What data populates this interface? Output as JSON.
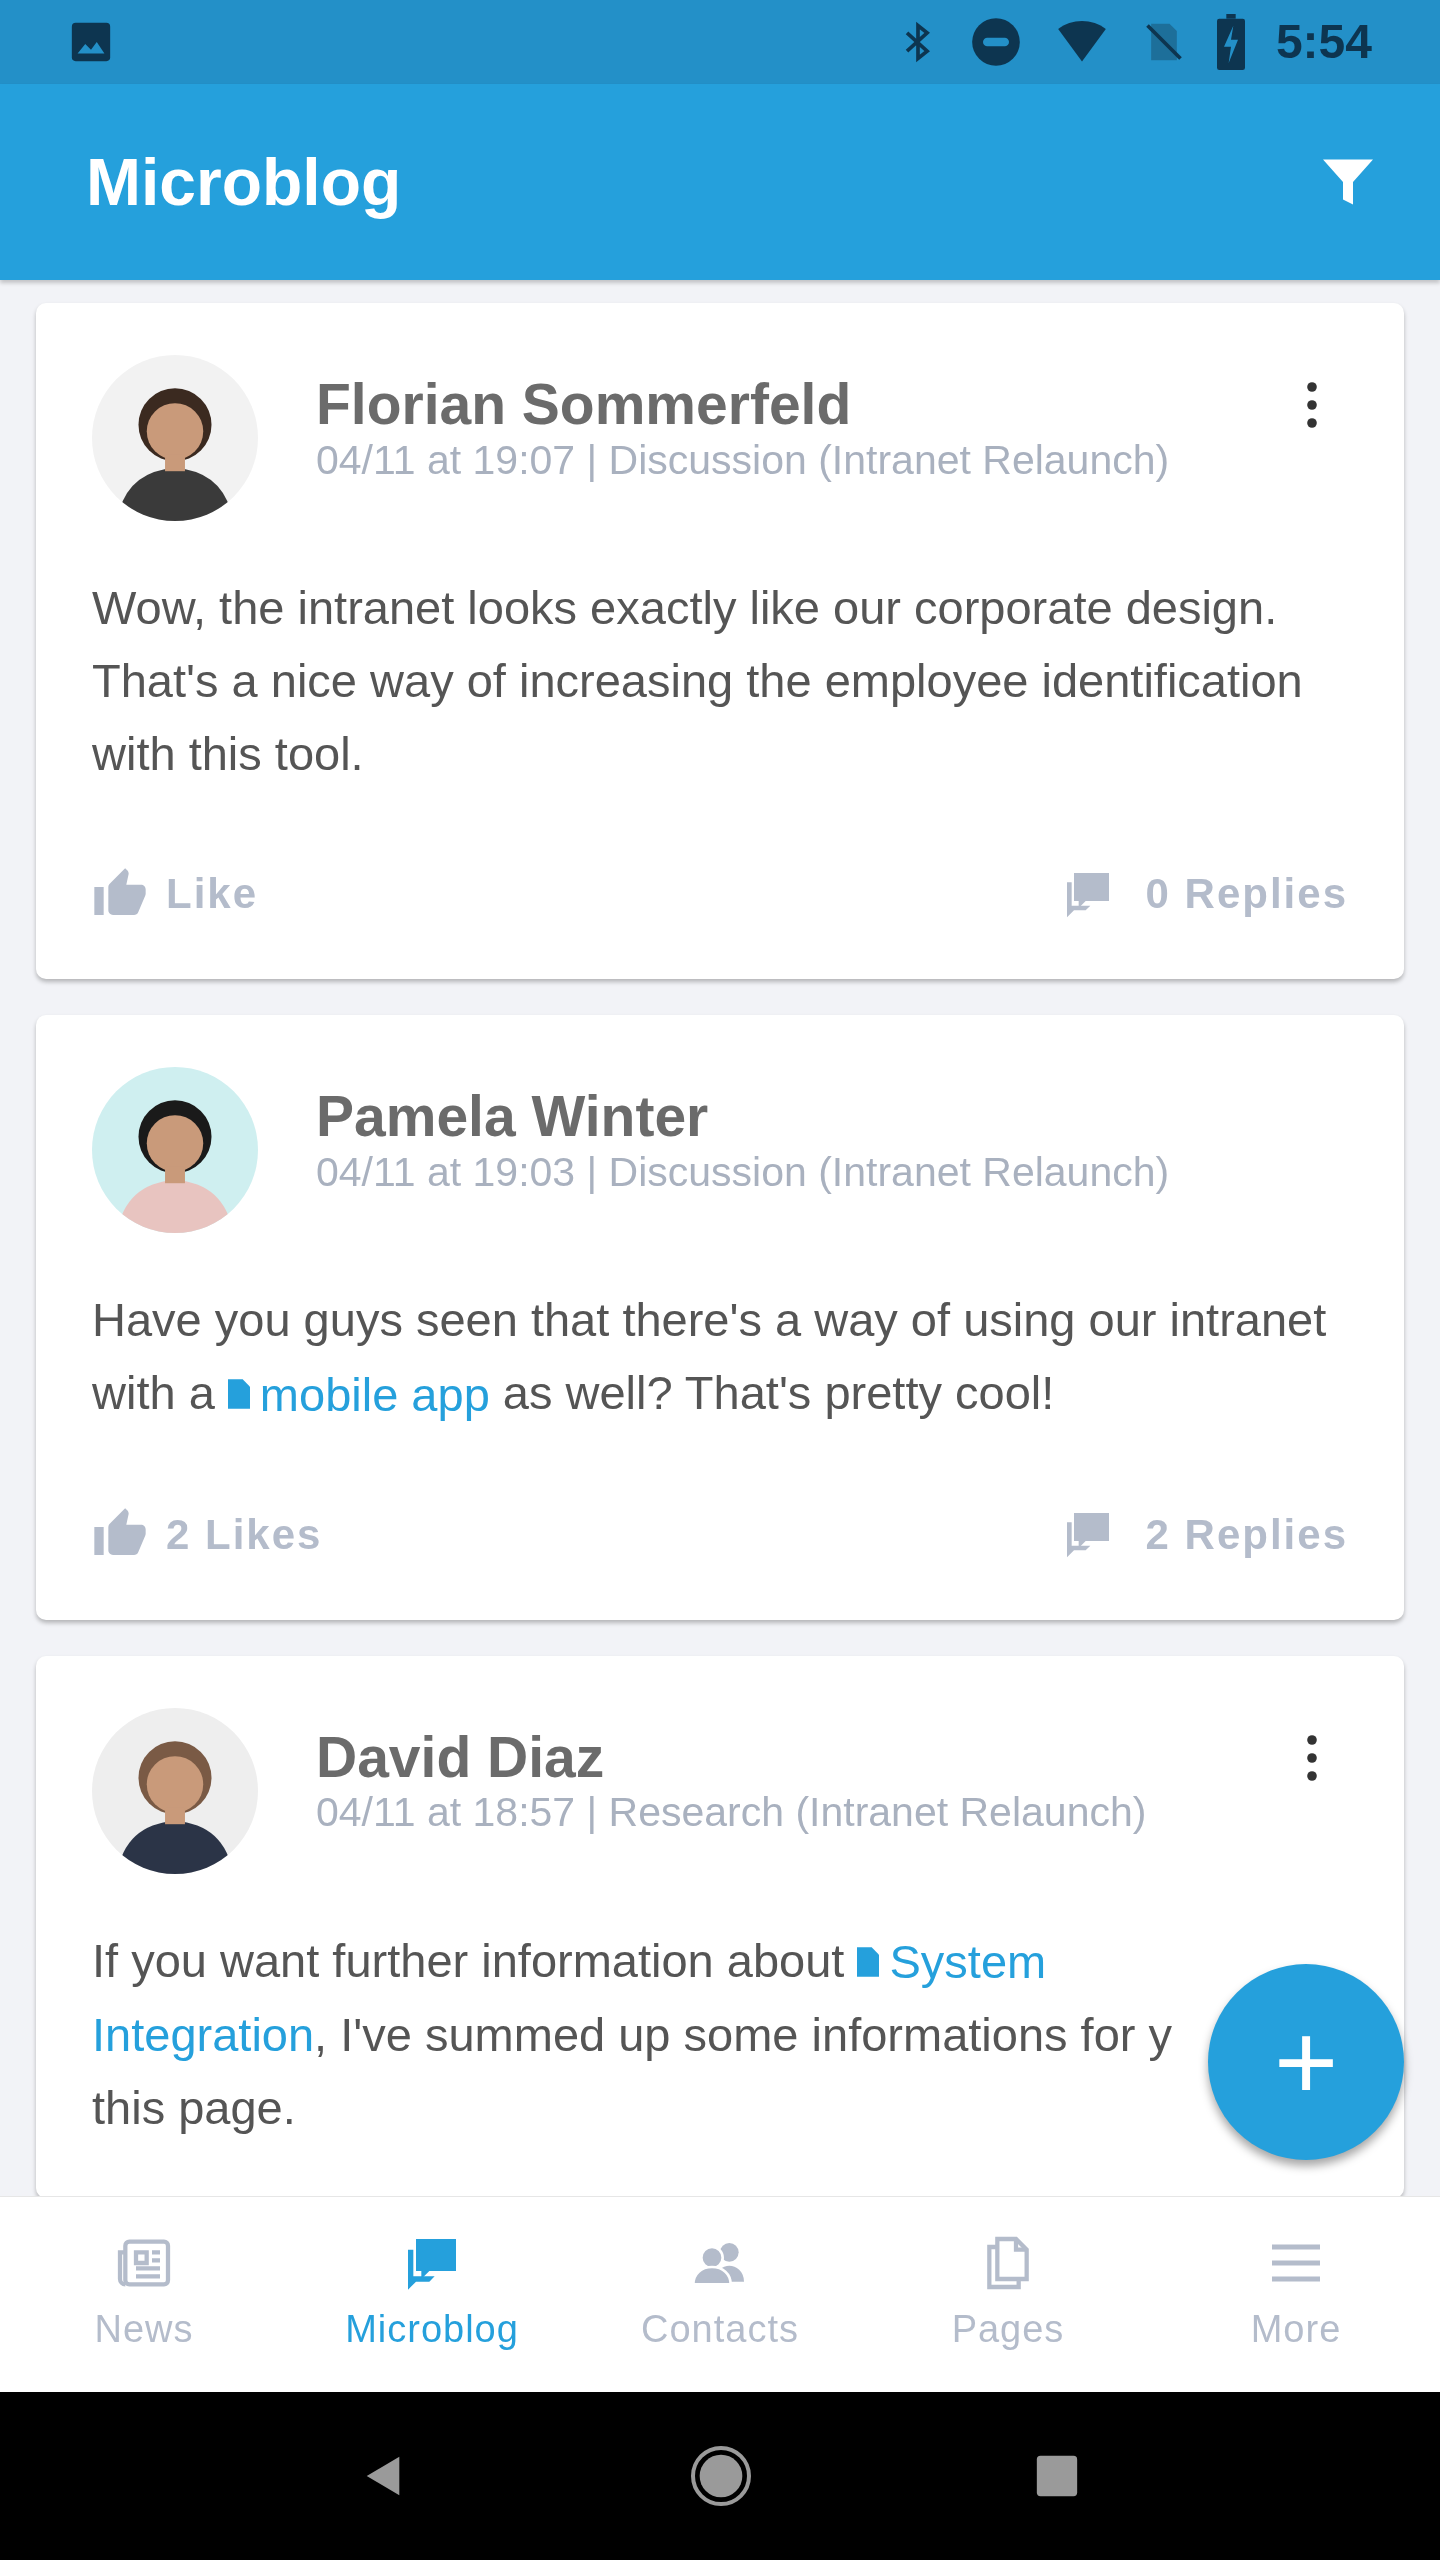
{
  "status_bar": {
    "time": "5:54"
  },
  "app_bar": {
    "title": "Microblog"
  },
  "posts": [
    {
      "author": "Florian Sommerfeld",
      "meta": "04/11 at 19:07 | Discussion (Intranet Relaunch)",
      "has_menu": true,
      "body": [
        {
          "kind": "text",
          "text": "Wow, the intranet looks exactly like our corporate design. That's a nice way of increasing the employee identification with this tool."
        }
      ],
      "like_label": "Like",
      "replies_label": "0 Replies"
    },
    {
      "author": "Pamela Winter",
      "meta": "04/11 at 19:03 | Discussion (Intranet Relaunch)",
      "has_menu": false,
      "body": [
        {
          "kind": "text",
          "text": "Have you guys seen that there's a way of using our intranet with a "
        },
        {
          "kind": "link",
          "text": "mobile app"
        },
        {
          "kind": "text",
          "text": " as well? That's pretty cool!"
        }
      ],
      "like_label": "2 Likes",
      "replies_label": "2 Replies"
    },
    {
      "author": "David Diaz",
      "meta": "04/11 at 18:57 | Research (Intranet Relaunch)",
      "has_menu": true,
      "body": [
        {
          "kind": "text",
          "text": "If you want further information about "
        },
        {
          "kind": "link",
          "text": "System"
        },
        {
          "kind": "break"
        },
        {
          "kind": "link_continued",
          "text": "Integration"
        },
        {
          "kind": "text",
          "text": ", I've summed up some informations for y"
        },
        {
          "kind": "break"
        },
        {
          "kind": "text",
          "text": "this page."
        }
      ]
    }
  ],
  "fab": {
    "label": "+"
  },
  "bottom_nav": [
    {
      "label": "News",
      "kind": "news",
      "selected": false
    },
    {
      "label": "Microblog",
      "kind": "chat",
      "selected": true
    },
    {
      "label": "Contacts",
      "kind": "people",
      "selected": false
    },
    {
      "label": "Pages",
      "kind": "pages",
      "selected": false
    },
    {
      "label": "More",
      "kind": "menu",
      "selected": false
    }
  ]
}
